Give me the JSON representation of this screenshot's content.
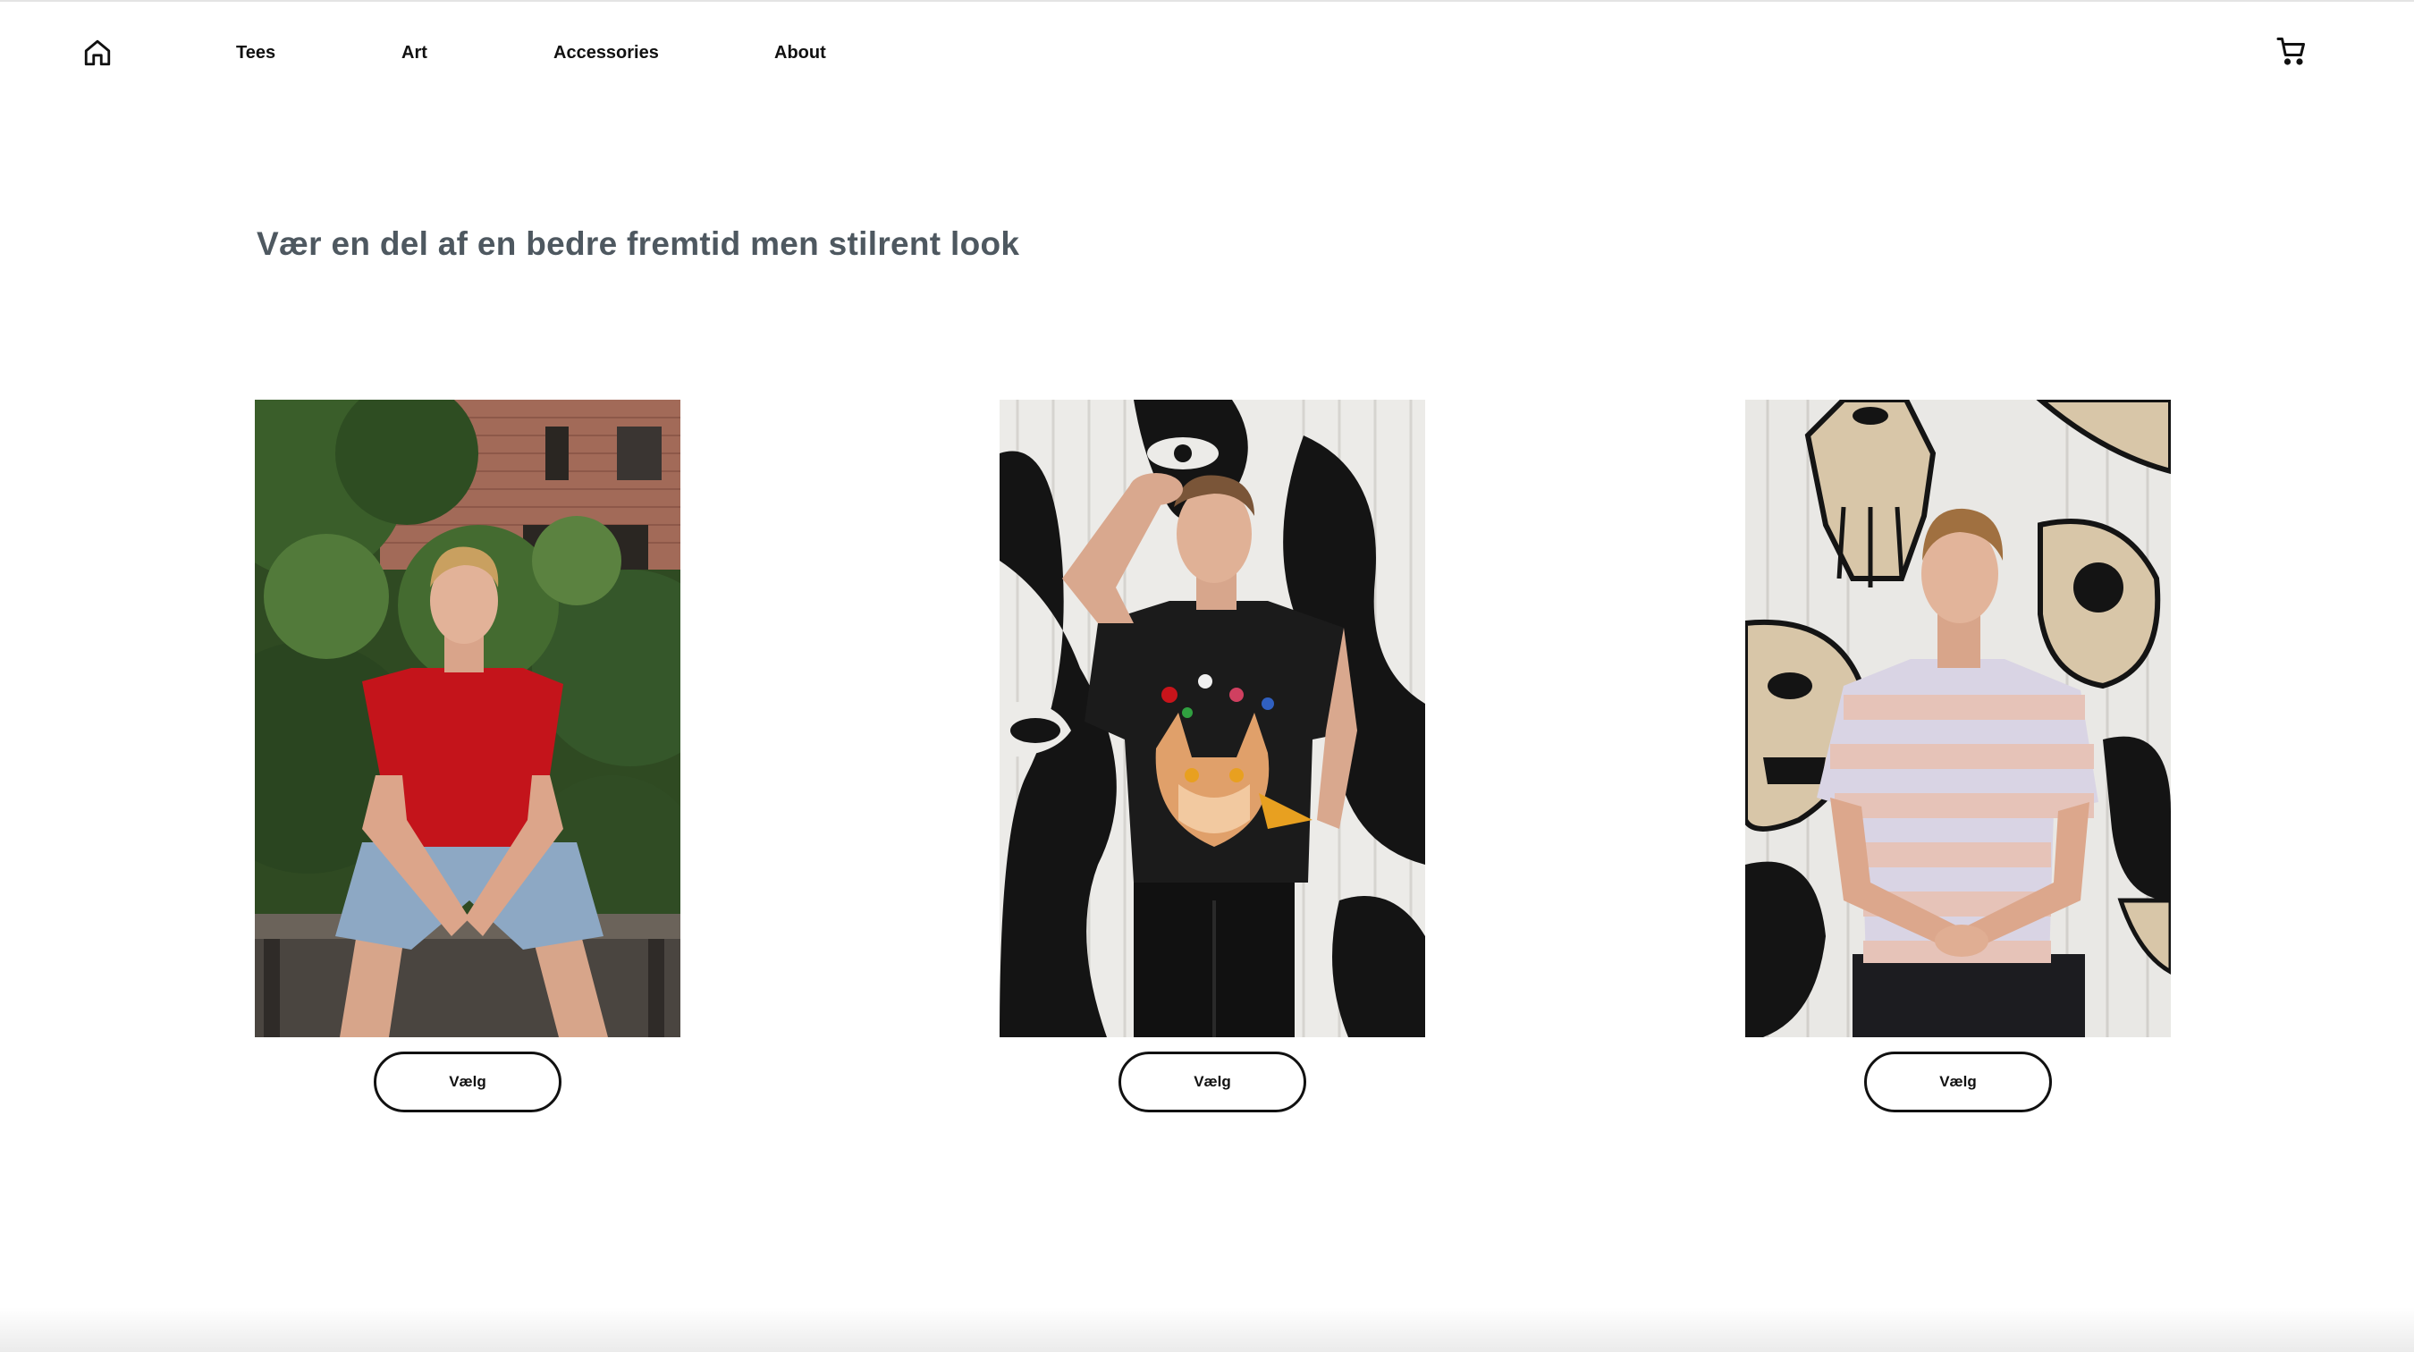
{
  "nav": {
    "home_icon": "home-icon",
    "links": [
      "Tees",
      "Art",
      "Accessories",
      "About"
    ],
    "cart_icon": "cart-icon"
  },
  "hero": {
    "headline": "Vær en del af en bedre fremtid men stilrent look"
  },
  "products": [
    {
      "button_label": "Vælg",
      "photo": "model-red-tee-photo"
    },
    {
      "button_label": "Vælg",
      "photo": "model-black-cat-tee-photo"
    },
    {
      "button_label": "Vælg",
      "photo": "model-striped-tee-photo"
    }
  ],
  "colors": {
    "text": "#111111",
    "headline": "#4e5860",
    "background": "#ffffff"
  }
}
